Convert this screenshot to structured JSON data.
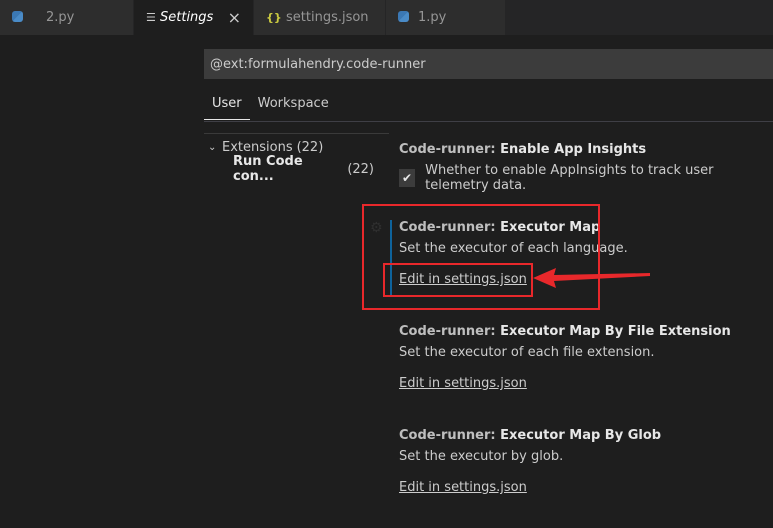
{
  "tabs": [
    {
      "label": "2.py",
      "icon": "python-file-icon",
      "active": false
    },
    {
      "label": "Settings",
      "icon": "settings-icon",
      "active": true
    },
    {
      "label": "settings.json",
      "icon": "json-file-icon",
      "active": false
    },
    {
      "label": "1.py",
      "icon": "python-file-icon",
      "active": false
    }
  ],
  "tab_close_glyph": "×",
  "search": {
    "value": "@ext:formulahendry.code-runner"
  },
  "scope_tabs": [
    {
      "label": "User",
      "active": true
    },
    {
      "label": "Workspace",
      "active": false
    }
  ],
  "toc": {
    "group_label": "Extensions",
    "group_count": "(22)",
    "child_label": "Run Code con...",
    "child_count": "(22)"
  },
  "settings": [
    {
      "category": "Code-runner: ",
      "name": "Enable App Insights",
      "description": "Whether to enable AppInsights to track user telemetry data.",
      "checked": true
    },
    {
      "category": "Code-runner: ",
      "name": "Executor Map",
      "description": "Set the executor of each language.",
      "link": "Edit in settings.json"
    },
    {
      "category": "Code-runner: ",
      "name": "Executor Map By File Extension",
      "description": "Set the executor of each file extension.",
      "link": "Edit in settings.json"
    },
    {
      "category": "Code-runner: ",
      "name": "Executor Map By Glob",
      "description": "Set the executor by glob.",
      "link": "Edit in settings.json"
    }
  ],
  "colors": {
    "background": "#1e1e1e",
    "annotation": "#e8282b",
    "focus": "#0e639c"
  }
}
